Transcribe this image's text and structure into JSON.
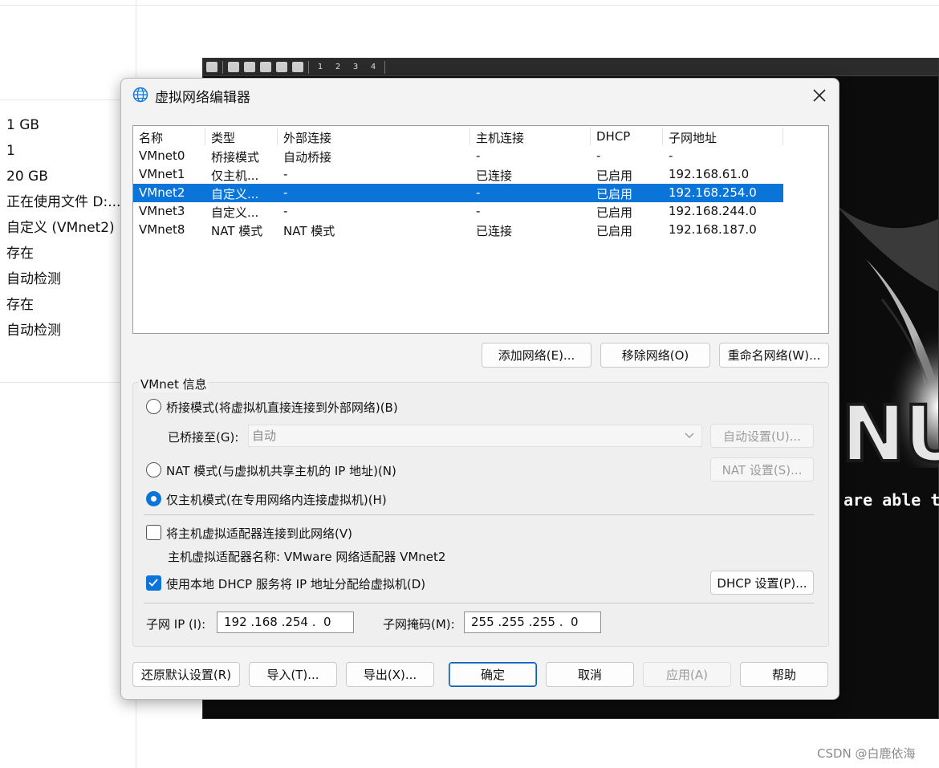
{
  "background_panel": {
    "values": [
      "1 GB",
      "1",
      "20 GB",
      "正在使用文件 D:...",
      "自定义 (VMnet2)",
      "存在",
      "自动检测",
      "存在",
      "自动检测"
    ]
  },
  "vm": {
    "toolbar_numbers": [
      "1",
      "2",
      "3",
      "4"
    ],
    "logo_text": "NU",
    "tagline": "are able t"
  },
  "dialog": {
    "title": "虚拟网络编辑器",
    "table": {
      "columns": [
        "名称",
        "类型",
        "外部连接",
        "主机连接",
        "DHCP",
        "子网地址"
      ],
      "rows": [
        {
          "name": "VMnet0",
          "type": "桥接模式",
          "external": "自动桥接",
          "host": "-",
          "dhcp": "-",
          "subnet": "-"
        },
        {
          "name": "VMnet1",
          "type": "仅主机...",
          "external": "-",
          "host": "已连接",
          "dhcp": "已启用",
          "subnet": "192.168.61.0"
        },
        {
          "name": "VMnet2",
          "type": "自定义...",
          "external": "-",
          "host": "-",
          "dhcp": "已启用",
          "subnet": "192.168.254.0"
        },
        {
          "name": "VMnet3",
          "type": "自定义...",
          "external": "-",
          "host": "-",
          "dhcp": "已启用",
          "subnet": "192.168.244.0"
        },
        {
          "name": "VMnet8",
          "type": "NAT 模式",
          "external": "NAT 模式",
          "host": "已连接",
          "dhcp": "已启用",
          "subnet": "192.168.187.0"
        }
      ],
      "selected_row": "VMnet2"
    },
    "net_buttons": {
      "add": "添加网络(E)...",
      "remove": "移除网络(O)",
      "rename": "重命名网络(W)..."
    },
    "info": {
      "group_label": "VMnet 信息",
      "bridged_label": "桥接模式(将虚拟机直接连接到外部网络)(B)",
      "bridged_to_label": "已桥接至(G):",
      "bridged_to_value": "自动",
      "auto_settings": "自动设置(U)...",
      "nat_label": "NAT 模式(与虚拟机共享主机的 IP 地址)(N)",
      "nat_settings": "NAT 设置(S)...",
      "hostonly_label": "仅主机模式(在专用网络内连接虚拟机)(H)",
      "selected_mode": "host-only",
      "connect_adapter_label": "将主机虚拟适配器连接到此网络(V)",
      "connect_adapter_checked": false,
      "adapter_name_text": "主机虚拟适配器名称: VMware 网络适配器 VMnet2",
      "dhcp_label": "使用本地 DHCP 服务将 IP 地址分配给虚拟机(D)",
      "dhcp_checked": true,
      "dhcp_settings": "DHCP 设置(P)...",
      "subnet_ip_label": "子网 IP (I):",
      "subnet_ip_value": "192 .168 .254 .  0",
      "subnet_mask_label": "子网掩码(M):",
      "subnet_mask_value": "255 .255 .255 .  0"
    },
    "footer_buttons": {
      "restore": "还原默认设置(R)",
      "import": "导入(T)...",
      "export": "导出(X)...",
      "ok": "确定",
      "cancel": "取消",
      "apply": "应用(A)",
      "help": "帮助"
    }
  },
  "watermark": "CSDN @白鹿依海"
}
